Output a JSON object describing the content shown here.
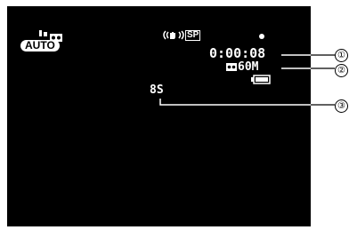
{
  "camcorder_display": {
    "program_mode": "AUTO",
    "tape_speed": "SP",
    "recording_indicator": "record-dot-icon",
    "timecode": "0:00:08",
    "remaining_tape": "60M",
    "slow_shutter": "8S",
    "battery": "battery-icon",
    "image_stabilizer": "image-stabilizer-icon",
    "cassette_icon": "cassette-icon"
  },
  "callouts": [
    "①",
    "②",
    "③"
  ],
  "colors": {
    "screen": "#000000",
    "osd_text": "#ffffff",
    "page": "#ffffff"
  }
}
